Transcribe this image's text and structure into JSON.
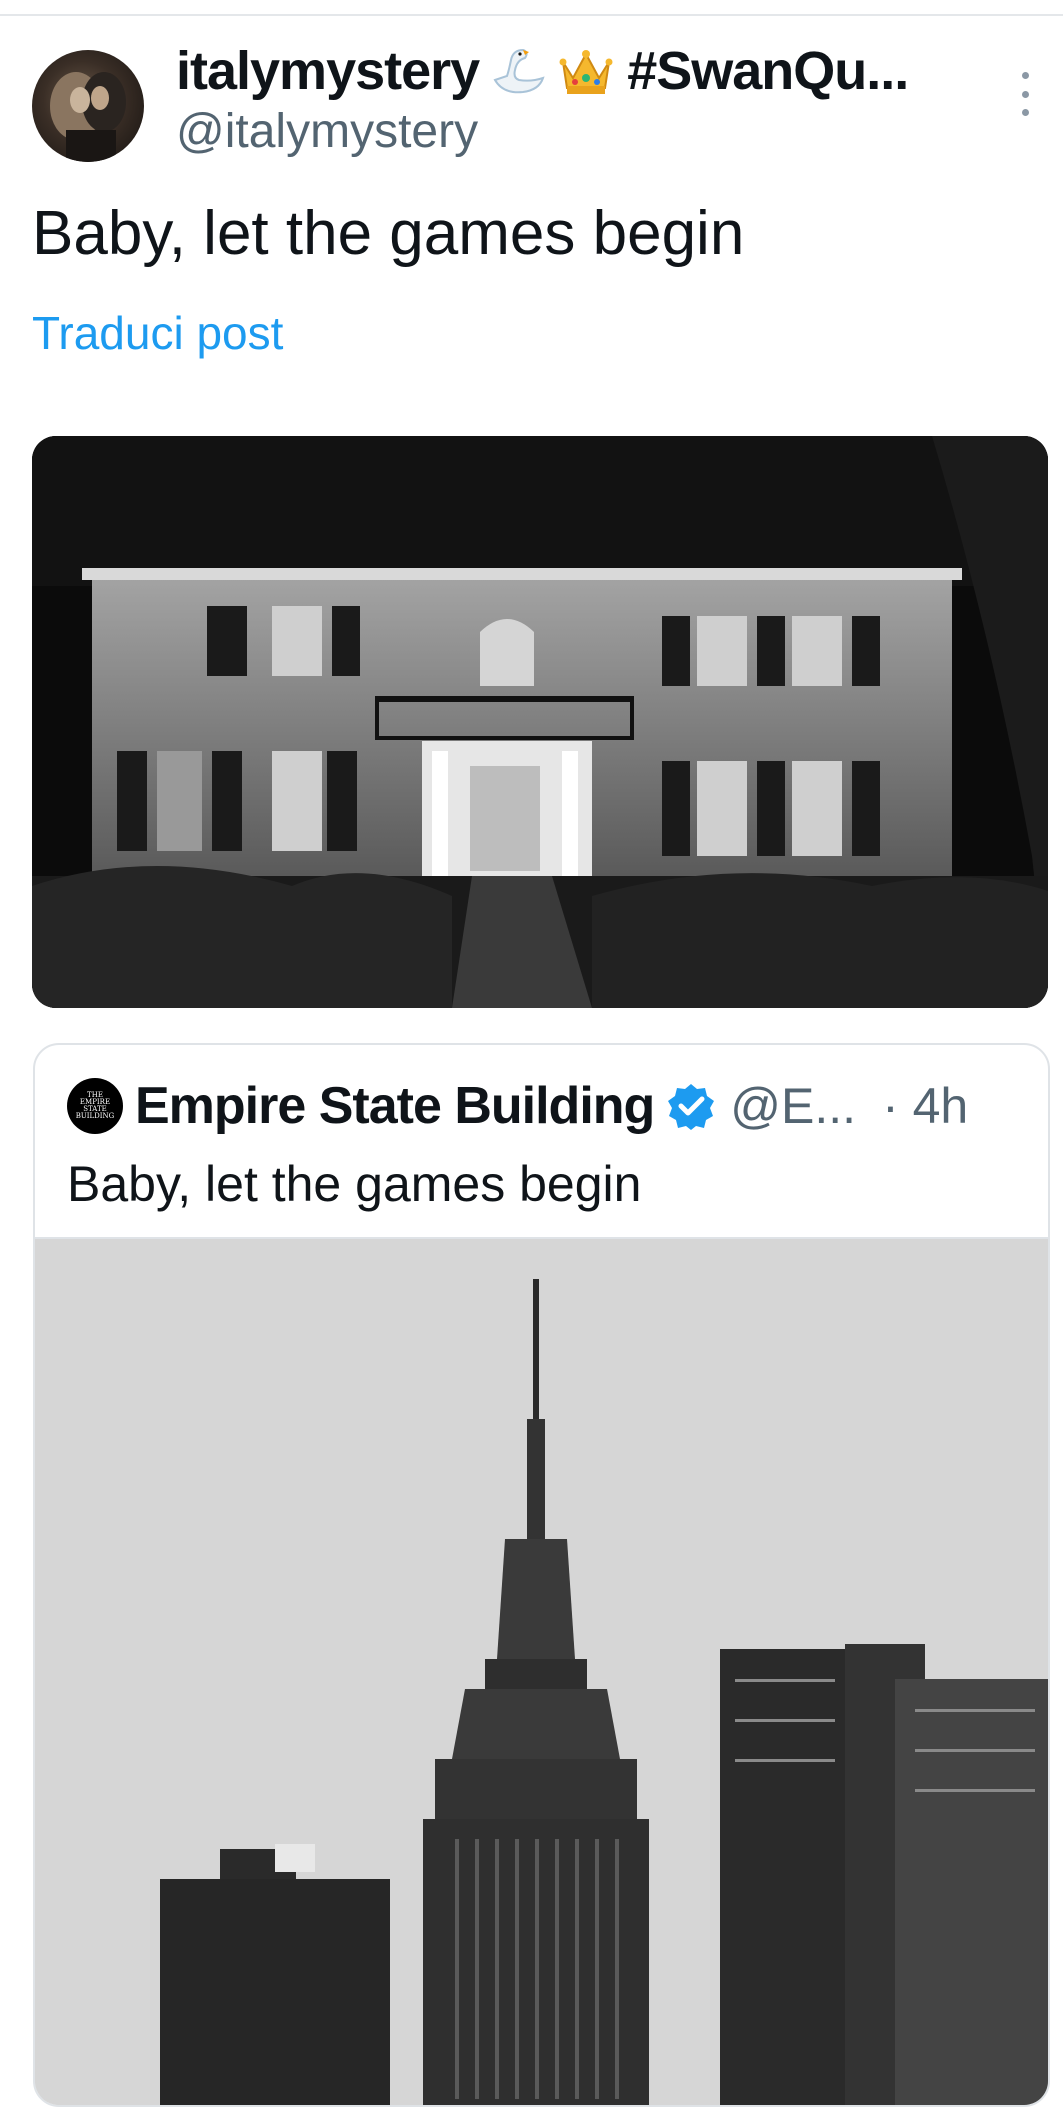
{
  "post": {
    "display_name": "italymystery",
    "name_emojis": [
      "swan-emoji",
      "crown-emoji"
    ],
    "hashtag": "#SwanQu...",
    "handle": "@italymystery",
    "text": "Baby, let the games begin",
    "translate_label": "Traduci post",
    "image_description_icon": "house-photo"
  },
  "quoted_post": {
    "avatar_text": [
      "THE",
      "EMPIRE",
      "STATE",
      "BUILDING"
    ],
    "name": "Empire State Building",
    "verified_icon": "verified-badge-icon",
    "handle": "@E...",
    "time": "· 4h",
    "text": "Baby, let the games begin",
    "image_icon": "skyline-photo"
  },
  "colors": {
    "link": "#1d9bf0",
    "secondary_text": "#536471",
    "verified": "#1d9bf0",
    "divider": "#e4e7ea"
  }
}
